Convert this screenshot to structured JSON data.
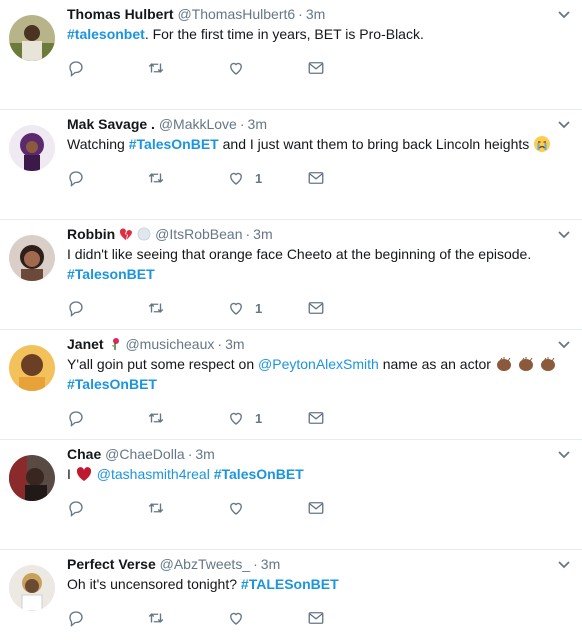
{
  "tweets": [
    {
      "name": "Thomas Hulbert",
      "handle": "@ThomasHulbert6",
      "time": "3m",
      "hashtag": "#talesonbet",
      "text_after": ". For the first time in years, BET is Pro-Black.",
      "likes": ""
    },
    {
      "name": "Mak Savage .",
      "handle": "@MakkLove",
      "time": "3m",
      "text_before": "Watching ",
      "hashtag": "#TalesOnBET",
      "text_after": " and I just want them to bring back Lincoln heights",
      "emoji": "crying-face-icon",
      "likes": "1"
    },
    {
      "name": "Robbin",
      "handle": "@ItsRobBean",
      "time": "3m",
      "line1": "I didn't like seeing that orange face Cheeto at the beginning of the episode.",
      "hashtag": "#TalesonBET",
      "likes": "1"
    },
    {
      "name": "Janet",
      "handle": "@musicheaux",
      "time": "3m",
      "line1_before": "Y'all goin put some respect on ",
      "mention": "@PeytonAlexSmith",
      "line1_after": " name as an actor",
      "hashtag": "#TalesOnBET",
      "likes": "1"
    },
    {
      "name": "Chae",
      "handle": "@ChaeDolla",
      "time": "3m",
      "text_before": "I",
      "mention": "@tashasmith4real",
      "hashtag": "#TalesOnBET",
      "likes": ""
    },
    {
      "name": "Perfect Verse",
      "handle": "@AbzTweets_",
      "time": "3m",
      "text_before": "Oh it's uncensored tonight? ",
      "hashtag": "#TALESonBET",
      "likes": ""
    }
  ],
  "separator": "·",
  "colors": {
    "link": "#1b95e0",
    "secondary": "#657786",
    "divider": "#e6ecf0"
  }
}
